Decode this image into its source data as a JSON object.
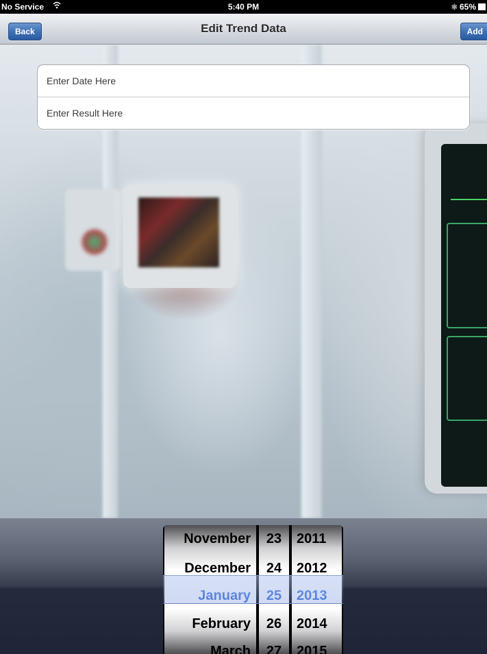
{
  "status_bar": {
    "carrier": "No Service",
    "time": "5:40 PM",
    "battery_percent": "65%"
  },
  "nav_bar": {
    "title": "Edit Trend Data",
    "back_label": "Back",
    "add_label": "Add",
    "button_color": "#3f71b6"
  },
  "form": {
    "date_placeholder": "Enter Date Here",
    "result_placeholder": "Enter Result Here"
  },
  "date_picker": {
    "months": [
      "November",
      "December",
      "January",
      "February",
      "March"
    ],
    "days": [
      "23",
      "24",
      "25",
      "26",
      "27"
    ],
    "years": [
      "2011",
      "2012",
      "2013",
      "2014",
      "2015"
    ],
    "selected": {
      "month": "January",
      "day": "25",
      "year": "2013"
    },
    "selected_color": "#3a6fd8"
  }
}
